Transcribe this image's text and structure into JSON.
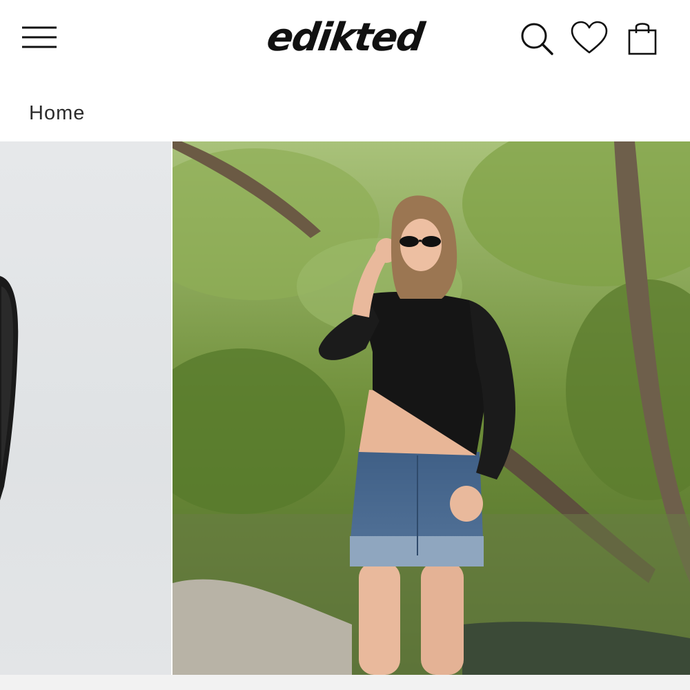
{
  "header": {
    "logo_text": "edikted",
    "menu_icon": "hamburger-menu-icon",
    "search_icon": "search-icon",
    "wishlist_icon": "heart-icon",
    "cart_icon": "shopping-bag-icon"
  },
  "breadcrumb": {
    "home_label": "Home"
  },
  "gallery": {
    "images": [
      {
        "description_icon": "product-image-icon"
      },
      {
        "description_icon": "product-image-icon"
      }
    ]
  },
  "colors": {
    "text": "#111111",
    "breadcrumb_text": "#2b2b2b",
    "background": "#ffffff"
  }
}
